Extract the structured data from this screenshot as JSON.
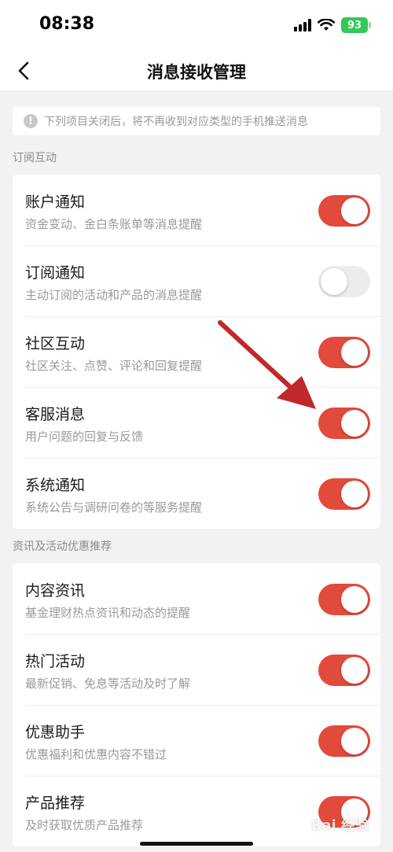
{
  "status_bar": {
    "time": "08:38",
    "battery": "93"
  },
  "nav": {
    "title": "消息接收管理"
  },
  "notice": {
    "icon": "!",
    "text": "下列项目关闭后，将不再收到对应类型的手机推送消息"
  },
  "sections": [
    {
      "title": "订阅互动",
      "items": [
        {
          "title": "账户通知",
          "subtitle": "资金变动、金白条账单等消息提醒",
          "enabled": true
        },
        {
          "title": "订阅通知",
          "subtitle": "主动订阅的活动和产品的消息提醒",
          "enabled": false
        },
        {
          "title": "社区互动",
          "subtitle": "社区关注、点赞、评论和回复提醒",
          "enabled": true
        },
        {
          "title": "客服消息",
          "subtitle": "用户问题的回复与反馈",
          "enabled": true
        },
        {
          "title": "系统通知",
          "subtitle": "系统公告与调研问卷的等服务提醒",
          "enabled": true
        }
      ]
    },
    {
      "title": "资讯及活动优惠推荐",
      "items": [
        {
          "title": "内容资讯",
          "subtitle": "基金理财热点资讯和动态的提醒",
          "enabled": true
        },
        {
          "title": "热门活动",
          "subtitle": "最新促销、免息等活动及时了解",
          "enabled": true
        },
        {
          "title": "优惠助手",
          "subtitle": "优惠福利和优惠内容不错过",
          "enabled": true
        },
        {
          "title": "产品推荐",
          "subtitle": "及时获取优质产品推荐",
          "enabled": true
        }
      ]
    }
  ],
  "colors": {
    "toggle_on": "#e24a3b",
    "toggle_off": "#ececee",
    "arrow": "#c0282b"
  },
  "icons": {
    "back": "chevron-left-icon",
    "notice": "info-icon",
    "annotation": "red-arrow-icon"
  },
  "watermark": {
    "text": "Bai 经验"
  }
}
